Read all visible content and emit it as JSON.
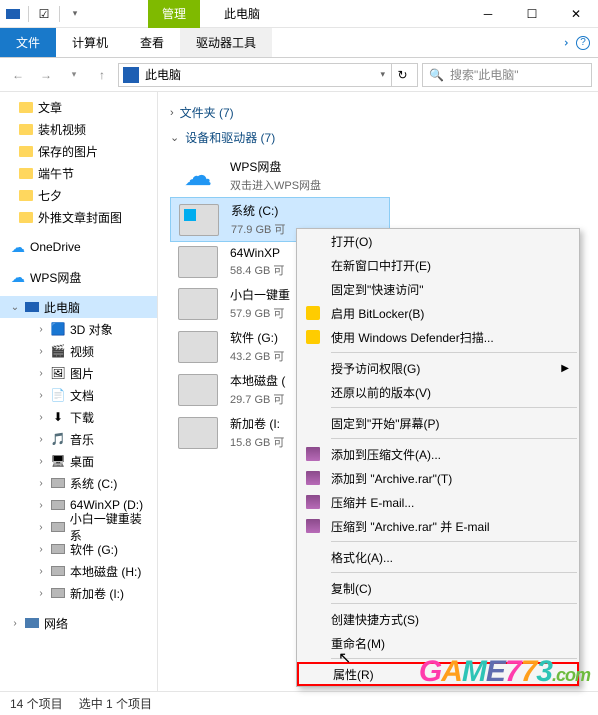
{
  "titlebar": {
    "manage_tab": "管理",
    "title": "此电脑"
  },
  "ribbon": {
    "file": "文件",
    "computer": "计算机",
    "view": "查看",
    "drive_tools": "驱动器工具"
  },
  "address": {
    "text": "此电脑"
  },
  "search": {
    "placeholder": "搜索\"此电脑\""
  },
  "sidebar": {
    "quick": [
      {
        "label": "文章"
      },
      {
        "label": "装机视频"
      },
      {
        "label": "保存的图片"
      },
      {
        "label": "端午节"
      },
      {
        "label": "七夕"
      },
      {
        "label": "外推文章封面图"
      }
    ],
    "onedrive": "OneDrive",
    "wps": "WPS网盘",
    "thispc": "此电脑",
    "pcitems": [
      {
        "label": "3D 对象"
      },
      {
        "label": "视频"
      },
      {
        "label": "图片"
      },
      {
        "label": "文档"
      },
      {
        "label": "下载"
      },
      {
        "label": "音乐"
      },
      {
        "label": "桌面"
      },
      {
        "label": "系统 (C:)"
      },
      {
        "label": "64WinXP  (D:)"
      },
      {
        "label": "小白一键重装系"
      },
      {
        "label": "软件 (G:)"
      },
      {
        "label": "本地磁盘 (H:)"
      },
      {
        "label": "新加卷 (I:)"
      }
    ],
    "network": "网络"
  },
  "content": {
    "folders_header": "文件夹 (7)",
    "devices_header": "设备和驱动器 (7)",
    "wps": {
      "name": "WPS网盘",
      "sub": "双击进入WPS网盘"
    },
    "drives": [
      {
        "name": "系统 (C:)",
        "sub": "77.9 GB 可"
      },
      {
        "name": "64WinXP",
        "sub": "58.4 GB 可"
      },
      {
        "name": "小白一键重",
        "sub": "57.9 GB 可"
      },
      {
        "name": "软件 (G:)",
        "sub": "43.2 GB 可"
      },
      {
        "name": "本地磁盘 (",
        "sub": "29.7 GB 可"
      },
      {
        "name": "新加卷 (I:",
        "sub": "15.8 GB 可"
      }
    ]
  },
  "context_menu": {
    "items": [
      {
        "label": "打开(O)"
      },
      {
        "label": "在新窗口中打开(E)"
      },
      {
        "label": "固定到\"快速访问\""
      },
      {
        "label": "启用 BitLocker(B)",
        "icon": "shield"
      },
      {
        "label": "使用 Windows Defender扫描...",
        "icon": "shield"
      },
      {
        "sep": true
      },
      {
        "label": "授予访问权限(G)",
        "arrow": true
      },
      {
        "label": "还原以前的版本(V)"
      },
      {
        "sep": true
      },
      {
        "label": "固定到\"开始\"屏幕(P)"
      },
      {
        "sep": true
      },
      {
        "label": "添加到压缩文件(A)...",
        "icon": "rar"
      },
      {
        "label": "添加到 \"Archive.rar\"(T)",
        "icon": "rar"
      },
      {
        "label": "压缩并 E-mail...",
        "icon": "rar"
      },
      {
        "label": "压缩到 \"Archive.rar\" 并 E-mail",
        "icon": "rar"
      },
      {
        "sep": true
      },
      {
        "label": "格式化(A)..."
      },
      {
        "sep": true
      },
      {
        "label": "复制(C)"
      },
      {
        "sep": true
      },
      {
        "label": "创建快捷方式(S)"
      },
      {
        "label": "重命名(M)"
      },
      {
        "sep": true
      },
      {
        "label": "属性(R)",
        "highlight": true
      }
    ]
  },
  "statusbar": {
    "items": "14 个项目",
    "selected": "选中 1 个项目"
  }
}
